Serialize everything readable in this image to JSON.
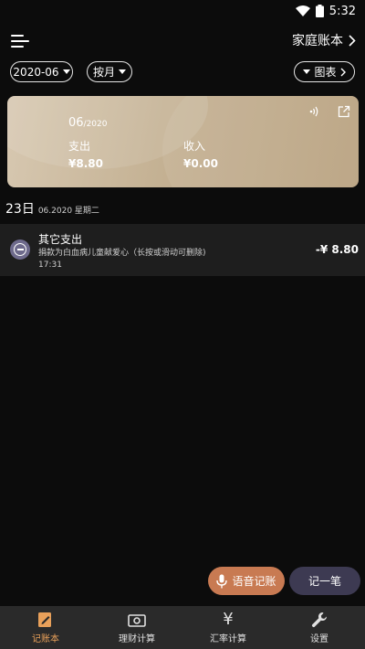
{
  "status_bar": {
    "time": "5:32"
  },
  "header": {
    "book_name": "家庭账本"
  },
  "filters": {
    "month": "2020-06",
    "mode": "按月",
    "chart": "图表"
  },
  "summary": {
    "month": "06",
    "year": "/2020",
    "expense_label": "支出",
    "expense_value": "¥8.80",
    "income_label": "收入",
    "income_value": "¥0.00"
  },
  "day_group": {
    "day": "23日",
    "date_sub": "06.2020 星期二"
  },
  "records": [
    {
      "category": "其它支出",
      "note": "捐款为白血病儿童献爱心（长按或滑动可删除)",
      "time": "17:31",
      "amount": "-¥ 8.80"
    }
  ],
  "actions": {
    "voice": "语音记账",
    "note": "记一笔"
  },
  "nav": [
    {
      "label": "记账本",
      "icon": "pencil-book-icon"
    },
    {
      "label": "理财计算",
      "icon": "banknote-icon"
    },
    {
      "label": "汇率计算",
      "icon": "yen-icon"
    },
    {
      "label": "设置",
      "icon": "wrench-icon"
    }
  ],
  "colors": {
    "accent": "#e8a05a",
    "voice_button": "#c87a52",
    "note_button": "#3d3a52",
    "record_icon": "#6e6a8c"
  }
}
